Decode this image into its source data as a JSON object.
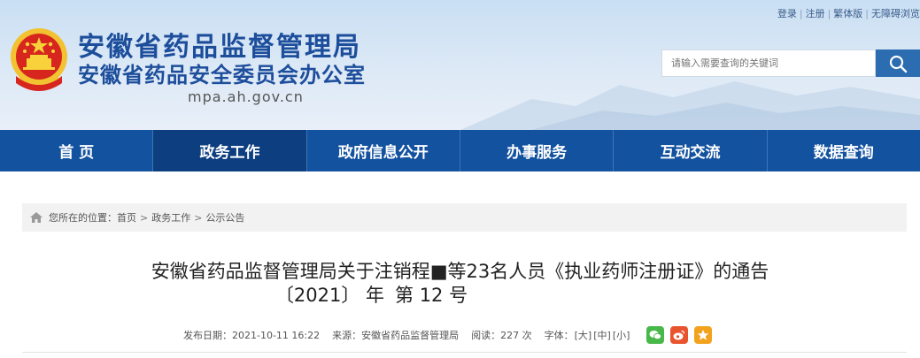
{
  "toplinks": [
    "登录",
    "注册",
    "繁体版",
    "无障碍浏览"
  ],
  "site": {
    "title_main": "安徽省药品监督管理局",
    "title_sub": "安徽省药品安全委员会办公室",
    "domain": "mpa.ah.gov.cn"
  },
  "search": {
    "placeholder": "请输入需要查询的关键词",
    "icon": "search-icon"
  },
  "nav": [
    "首 页",
    "政务工作",
    "政府信息公开",
    "办事服务",
    "互动交流",
    "数据查询"
  ],
  "nav_active": "政务工作",
  "breadcrumb": {
    "prefix": "您所在的位置：",
    "items": [
      "首页",
      "政务工作",
      "公示公告"
    ],
    "separator": ">"
  },
  "article": {
    "title": "安徽省药品监督管理局关于注销程■等23名人员《执业药师注册证》的通告",
    "number_year": "〔2021〕 年",
    "number_seq": "第 12 号"
  },
  "meta": {
    "date_label": "发布日期：",
    "date": "2021-10-11 16:22",
    "source_label": "来源：",
    "source": "安徽省药品监督管理局",
    "views_label": "阅读：",
    "views": "227 次",
    "font_label": "字体：",
    "font_large": "[大]",
    "font_medium": "[中]",
    "font_small": "[小]"
  },
  "colors": {
    "nav": "#13529f",
    "nav_active": "#0d3f80",
    "title": "#1d4e9c",
    "wechat": "#48b84a",
    "weibo": "#e8542d",
    "favorite": "#f3a21e"
  }
}
